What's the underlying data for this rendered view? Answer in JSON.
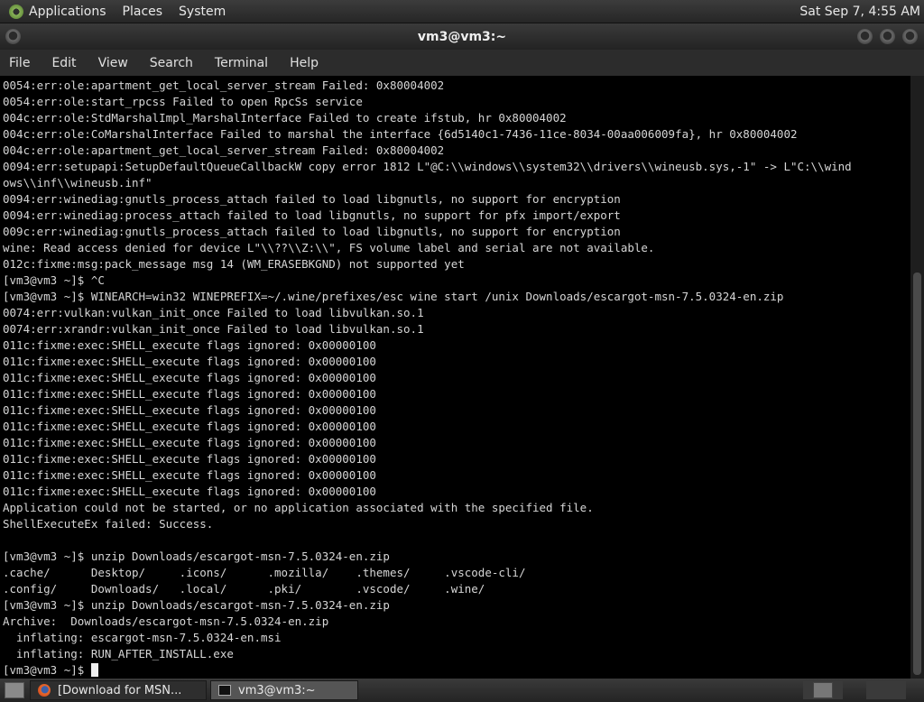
{
  "top_panel": {
    "menus": [
      "Applications",
      "Places",
      "System"
    ],
    "clock": "Sat Sep  7,  4:55 AM"
  },
  "window": {
    "title": "vm3@vm3:~",
    "menu": [
      "File",
      "Edit",
      "View",
      "Search",
      "Terminal",
      "Help"
    ]
  },
  "terminal": {
    "lines": [
      "0054:err:ole:apartment_get_local_server_stream Failed: 0x80004002",
      "0054:err:ole:start_rpcss Failed to open RpcSs service",
      "004c:err:ole:StdMarshalImpl_MarshalInterface Failed to create ifstub, hr 0x80004002",
      "004c:err:ole:CoMarshalInterface Failed to marshal the interface {6d5140c1-7436-11ce-8034-00aa006009fa}, hr 0x80004002",
      "004c:err:ole:apartment_get_local_server_stream Failed: 0x80004002",
      "0094:err:setupapi:SetupDefaultQueueCallbackW copy error 1812 L\"@C:\\\\windows\\\\system32\\\\drivers\\\\wineusb.sys,-1\" -> L\"C:\\\\wind",
      "ows\\\\inf\\\\wineusb.inf\"",
      "0094:err:winediag:gnutls_process_attach failed to load libgnutls, no support for encryption",
      "0094:err:winediag:process_attach failed to load libgnutls, no support for pfx import/export",
      "009c:err:winediag:gnutls_process_attach failed to load libgnutls, no support for encryption",
      "wine: Read access denied for device L\"\\\\??\\\\Z:\\\\\", FS volume label and serial are not available.",
      "012c:fixme:msg:pack_message msg 14 (WM_ERASEBKGND) not supported yet",
      "[vm3@vm3 ~]$ ^C",
      "[vm3@vm3 ~]$ WINEARCH=win32 WINEPREFIX=~/.wine/prefixes/esc wine start /unix Downloads/escargot-msn-7.5.0324-en.zip",
      "0074:err:vulkan:vulkan_init_once Failed to load libvulkan.so.1",
      "0074:err:xrandr:vulkan_init_once Failed to load libvulkan.so.1",
      "011c:fixme:exec:SHELL_execute flags ignored: 0x00000100",
      "011c:fixme:exec:SHELL_execute flags ignored: 0x00000100",
      "011c:fixme:exec:SHELL_execute flags ignored: 0x00000100",
      "011c:fixme:exec:SHELL_execute flags ignored: 0x00000100",
      "011c:fixme:exec:SHELL_execute flags ignored: 0x00000100",
      "011c:fixme:exec:SHELL_execute flags ignored: 0x00000100",
      "011c:fixme:exec:SHELL_execute flags ignored: 0x00000100",
      "011c:fixme:exec:SHELL_execute flags ignored: 0x00000100",
      "011c:fixme:exec:SHELL_execute flags ignored: 0x00000100",
      "011c:fixme:exec:SHELL_execute flags ignored: 0x00000100",
      "Application could not be started, or no application associated with the specified file.",
      "ShellExecuteEx failed: Success.",
      "",
      "[vm3@vm3 ~]$ unzip Downloads/escargot-msn-7.5.0324-en.zip",
      ".cache/      Desktop/     .icons/      .mozilla/    .themes/     .vscode-cli/",
      ".config/     Downloads/   .local/      .pki/        .vscode/     .wine/",
      "[vm3@vm3 ~]$ unzip Downloads/escargot-msn-7.5.0324-en.zip",
      "Archive:  Downloads/escargot-msn-7.5.0324-en.zip",
      "  inflating: escargot-msn-7.5.0324-en.msi",
      "  inflating: RUN_AFTER_INSTALL.exe"
    ],
    "prompt": "[vm3@vm3 ~]$ "
  },
  "taskbar": {
    "tasks": [
      {
        "label": "[Download for MSN...",
        "icon": "firefox-icon",
        "active": false
      },
      {
        "label": "vm3@vm3:~",
        "icon": "terminal-icon",
        "active": true
      }
    ]
  }
}
